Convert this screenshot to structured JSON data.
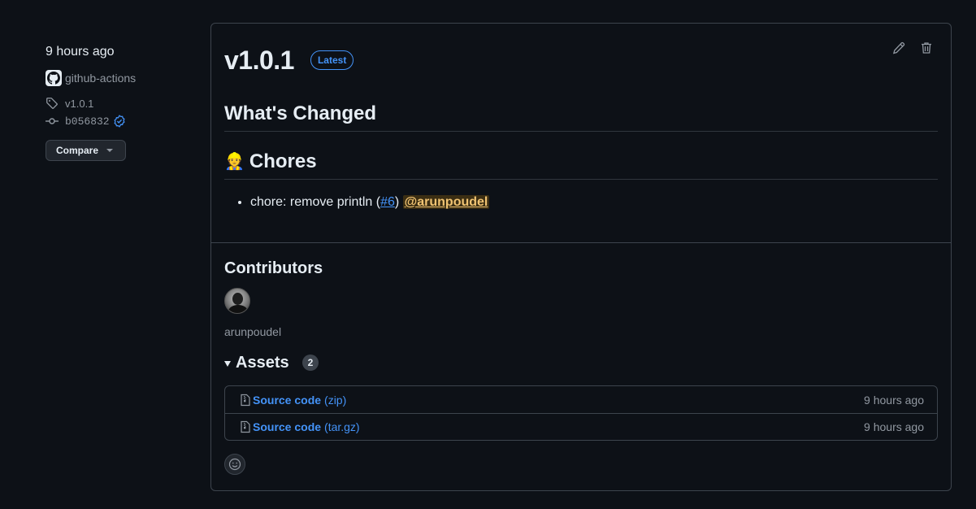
{
  "meta": {
    "time": "9 hours ago",
    "author": "github-actions",
    "tag": "v1.0.1",
    "commit": "b056832",
    "compare_label": "Compare"
  },
  "release": {
    "title": "v1.0.1",
    "badge": "Latest",
    "heading": "What's Changed",
    "section_emoji": "👷",
    "section_title": "Chores",
    "changes": [
      {
        "text": "chore: remove println (",
        "pr": "#6",
        "close": ")",
        "mention": "@arunpoudel"
      }
    ]
  },
  "contributors": {
    "title": "Contributors",
    "names": [
      "arunpoudel"
    ]
  },
  "assets": {
    "title": "Assets",
    "count": "2",
    "items": [
      {
        "name": "Source code",
        "ext": "(zip)",
        "time": "9 hours ago"
      },
      {
        "name": "Source code",
        "ext": "(tar.gz)",
        "time": "9 hours ago"
      }
    ]
  },
  "colors": {
    "background": "#0d1117",
    "accent": "#4493f8",
    "border": "#3d444d",
    "mention_bg": "#3b2e13",
    "mention_fg": "#f0c372"
  }
}
